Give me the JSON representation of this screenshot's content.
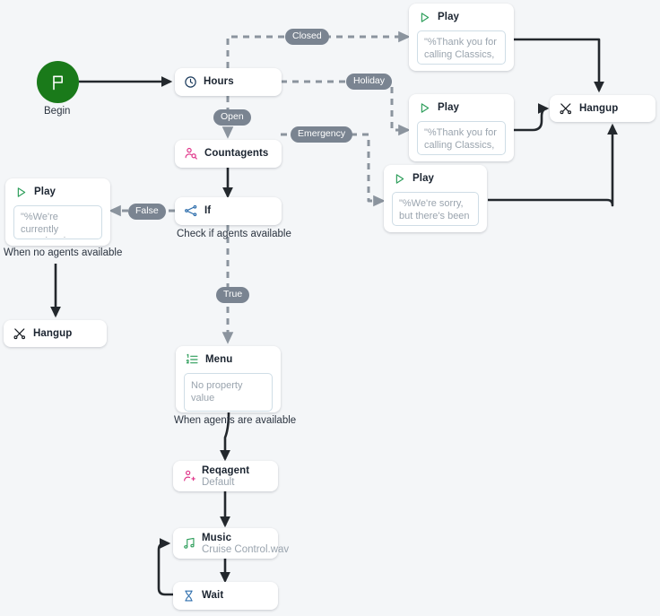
{
  "canvas": {
    "background": "#f4f6f8",
    "node_bg": "#ffffff",
    "solid_edge_color": "#23282d",
    "dashed_edge_color": "#8b949e",
    "pill_bg": "#7a8491",
    "begin_color": "#1a7a1a",
    "accent_green": "#2e9e5b",
    "accent_pink": "#e0368a",
    "accent_blue": "#2f6fad",
    "accent_navy": "#1b3a5c"
  },
  "start": {
    "icon": "flag-icon",
    "caption": "Begin"
  },
  "nodes": {
    "hours": {
      "title": "Hours",
      "icon": "clock-icon"
    },
    "countagents": {
      "title": "Countagents",
      "icon": "person-search-icon"
    },
    "if": {
      "title": "If",
      "icon": "branch-icon",
      "caption": "Check if agents available"
    },
    "play_no_agents": {
      "title": "Play",
      "icon": "play-triangle-icon",
      "property": "\"%We're currently experiencing …",
      "caption": "When no agents available"
    },
    "hangup_left": {
      "title": "Hangup",
      "icon": "call-end-icon"
    },
    "play_closed": {
      "title": "Play",
      "icon": "play-triangle-icon",
      "property": "\"%Thank you for calling Classics, …"
    },
    "play_holiday": {
      "title": "Play",
      "icon": "play-triangle-icon",
      "property": "\"%Thank you for calling Classics, …"
    },
    "play_emergency": {
      "title": "Play",
      "icon": "play-triangle-icon",
      "property": "\"%We're sorry, but there's been a …"
    },
    "hangup_right": {
      "title": "Hangup",
      "icon": "call-end-icon"
    },
    "menu": {
      "title": "Menu",
      "icon": "numbered-list-icon",
      "property": "No property value",
      "caption": "When agents are available"
    },
    "reqagent": {
      "title": "Reqagent",
      "subtitle": "Default",
      "icon": "person-add-icon"
    },
    "music": {
      "title": "Music",
      "subtitle": "Cruise Control.wav",
      "icon": "music-note-icon"
    },
    "wait": {
      "title": "Wait",
      "icon": "hourglass-icon"
    }
  },
  "edge_labels": {
    "closed": "Closed",
    "holiday": "Holiday",
    "emergency": "Emergency",
    "open": "Open",
    "false": "False",
    "true": "True"
  }
}
